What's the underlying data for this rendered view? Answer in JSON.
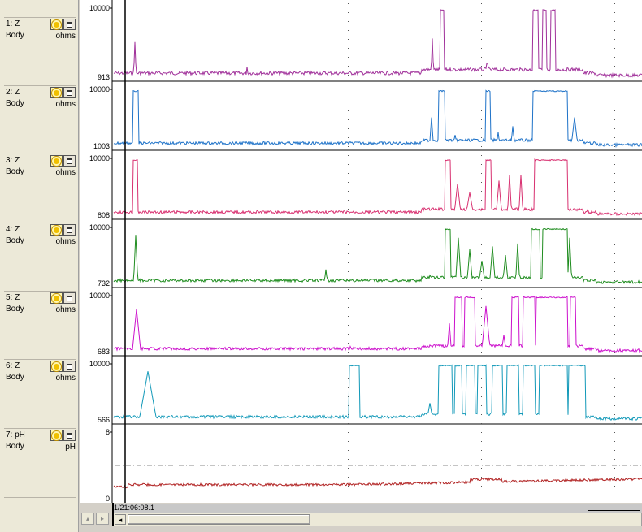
{
  "channels": [
    {
      "name": "1: Z",
      "location": "Body",
      "unit": "ohms",
      "ymax": "10000",
      "ymin": "913",
      "color": "#a0309a"
    },
    {
      "name": "2: Z",
      "location": "Body",
      "unit": "ohms",
      "ymax": "10000",
      "ymin": "1003",
      "color": "#1e72c8"
    },
    {
      "name": "3: Z",
      "location": "Body",
      "unit": "ohms",
      "ymax": "10000",
      "ymin": "808",
      "color": "#d83070"
    },
    {
      "name": "4: Z",
      "location": "Body",
      "unit": "ohms",
      "ymax": "10000",
      "ymin": "732",
      "color": "#1e8c1e"
    },
    {
      "name": "5: Z",
      "location": "Body",
      "unit": "ohms",
      "ymax": "10000",
      "ymin": "683",
      "color": "#cc10cc"
    },
    {
      "name": "6: Z",
      "location": "Body",
      "unit": "ohms",
      "ymax": "10000",
      "ymin": "566",
      "color": "#1098b8"
    },
    {
      "name": "7: pH",
      "location": "Body",
      "unit": "pH",
      "ymax": "8",
      "ymin": "0",
      "color": "#b02020"
    }
  ],
  "time_label": "1/21:06:08.1",
  "icons": {
    "visibility": "lightbulb-icon",
    "lock": "lock-icon"
  },
  "nav": {
    "left": "◂",
    "right": "▸"
  }
}
